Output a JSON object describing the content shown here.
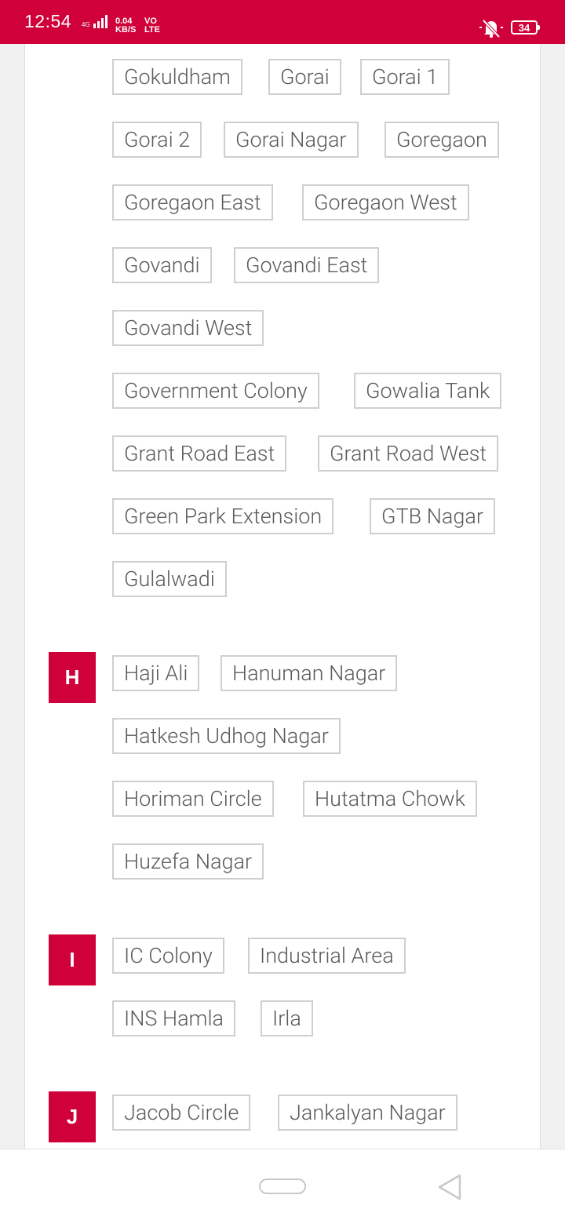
{
  "status_bar": {
    "time": "12:54",
    "network_tag": "4G",
    "speed_value": "0.04",
    "speed_unit": "KB/S",
    "volte_top": "VO",
    "volte_bottom": "LTE",
    "battery": "34",
    "icons": [
      "signal-icon",
      "mute-icon",
      "battery-icon"
    ]
  },
  "colors": {
    "accent": "#d0003b",
    "chip_border": "#cfcfcf",
    "chip_text": "#5b5b5b"
  },
  "sections": [
    {
      "letter": "",
      "items": [
        "Gokuldham",
        "Gorai",
        "Gorai 1",
        "Gorai 2",
        "Gorai Nagar",
        "Goregaon",
        "Goregaon East",
        "Goregaon West",
        "Govandi",
        "Govandi East",
        "Govandi West",
        "Government Colony",
        "Gowalia Tank",
        "Grant Road East",
        "Grant Road West",
        "Green Park Extension",
        "GTB Nagar",
        "Gulalwadi"
      ]
    },
    {
      "letter": "H",
      "items": [
        "Haji Ali",
        "Hanuman Nagar",
        "Hatkesh Udhog Nagar",
        "Horiman Circle",
        "Hutatma Chowk",
        "Huzefa Nagar"
      ]
    },
    {
      "letter": "I",
      "items": [
        "IC Colony",
        "Industrial Area",
        "INS Hamla",
        "Irla"
      ]
    },
    {
      "letter": "J",
      "items": [
        "Jacob Circle",
        "Jankalyan Nagar"
      ]
    }
  ],
  "nav_bar": {
    "icons": [
      "home-pill-icon",
      "back-triangle-icon"
    ]
  }
}
